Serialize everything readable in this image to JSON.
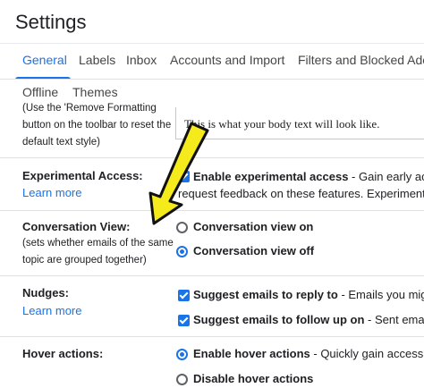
{
  "header": {
    "title": "Settings"
  },
  "tabs": [
    {
      "label": "General"
    },
    {
      "label": "Labels"
    },
    {
      "label": "Inbox"
    },
    {
      "label": "Accounts and Import"
    },
    {
      "label": "Filters and Blocked Adc"
    },
    {
      "label": "Offline"
    },
    {
      "label": "Themes"
    }
  ],
  "default_text_style": {
    "help_lines": [
      "(Use the 'Remove Formatting",
      "button on the toolbar to reset the",
      "default text style)"
    ],
    "preview_text": "This is what your body text will look like."
  },
  "experimental_access": {
    "label": "Experimental Access:",
    "learn_more": "Learn more",
    "option_bold": "Enable experimental access",
    "option_rest": " - Gain early acce",
    "option_line2": "request feedback on these features. Experiment"
  },
  "conversation_view": {
    "label": "Conversation View:",
    "help_lines": [
      "(sets whether emails of the same",
      "topic are grouped together)"
    ],
    "options": [
      {
        "label": "Conversation view on",
        "checked": false
      },
      {
        "label": "Conversation view off",
        "checked": true
      }
    ]
  },
  "nudges": {
    "label": "Nudges:",
    "learn_more": "Learn more",
    "options": [
      {
        "bold": "Suggest emails to reply to",
        "rest": " - Emails you migh",
        "checked": true
      },
      {
        "bold": "Suggest emails to follow up on",
        "rest": " - Sent emails",
        "checked": true
      }
    ]
  },
  "hover_actions": {
    "label": "Hover actions:",
    "options": [
      {
        "bold": "Enable hover actions",
        "rest": " - Quickly gain access to",
        "checked": true
      },
      {
        "bold": "Disable hover actions",
        "rest": "",
        "checked": false
      }
    ]
  },
  "colors": {
    "accent": "#1a73e8",
    "arrow_fill": "#f4ea1c",
    "arrow_stroke": "#111111"
  }
}
